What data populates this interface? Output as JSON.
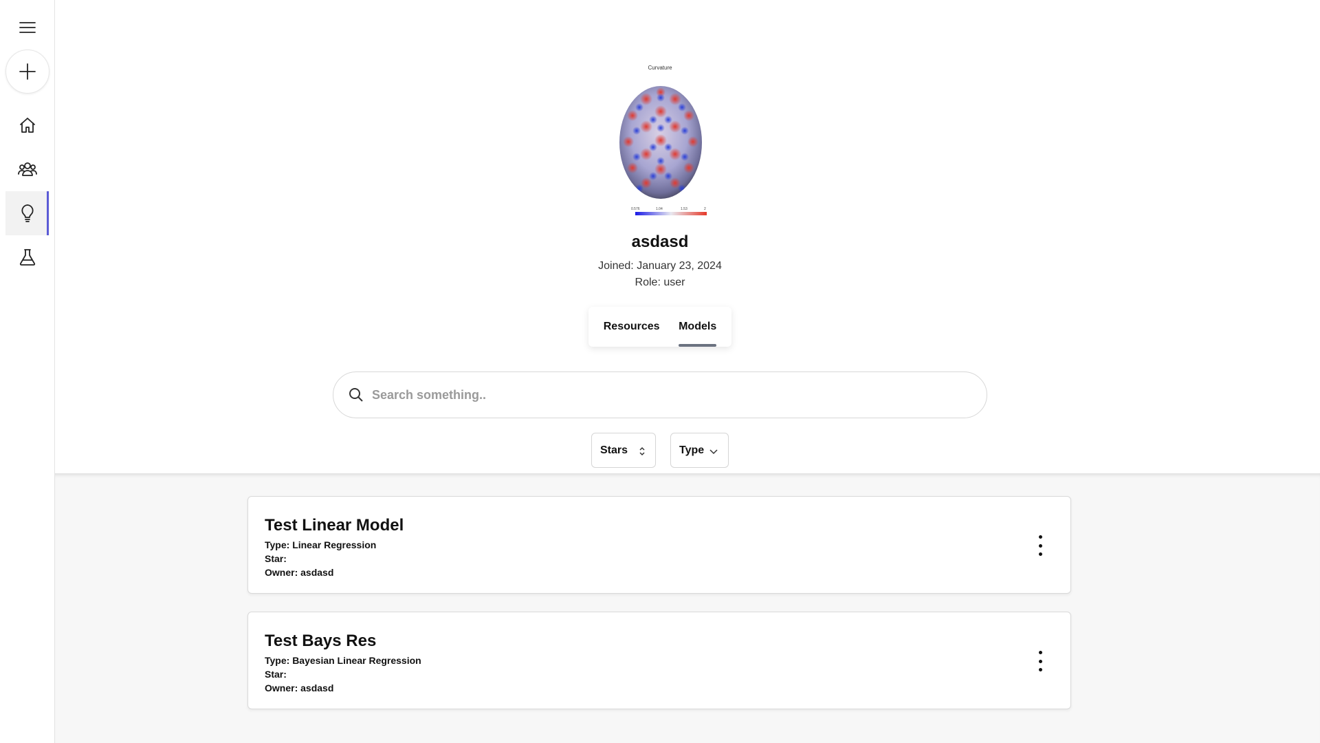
{
  "sidebar": {
    "items": [
      {
        "icon": "menu-icon"
      },
      {
        "icon": "plus-icon"
      },
      {
        "icon": "home-icon"
      },
      {
        "icon": "people-icon"
      },
      {
        "icon": "lightbulb-icon",
        "active": true
      },
      {
        "icon": "flask-icon"
      }
    ],
    "accent": "#5b5bd6"
  },
  "profile": {
    "avatar_caption": "Curvature",
    "colorbar_ticks": [
      "0.576",
      "1.04",
      "1.53",
      "2"
    ],
    "username": "asdasd",
    "joined": "Joined: January 23, 2024",
    "role": "Role: user"
  },
  "tabs": [
    {
      "label": "Resources",
      "active": false
    },
    {
      "label": "Models",
      "active": true
    }
  ],
  "search": {
    "placeholder": "Search something.."
  },
  "filters": {
    "stars_label": "Stars",
    "type_label": "Type"
  },
  "models": [
    {
      "title": "Test Linear Model",
      "type": "Type: Linear Regression",
      "star": "Star:",
      "owner": "Owner: asdasd"
    },
    {
      "title": "Test Bays Res",
      "type": "Type: Bayesian Linear Regression",
      "star": "Star:",
      "owner": "Owner: asdasd"
    }
  ]
}
